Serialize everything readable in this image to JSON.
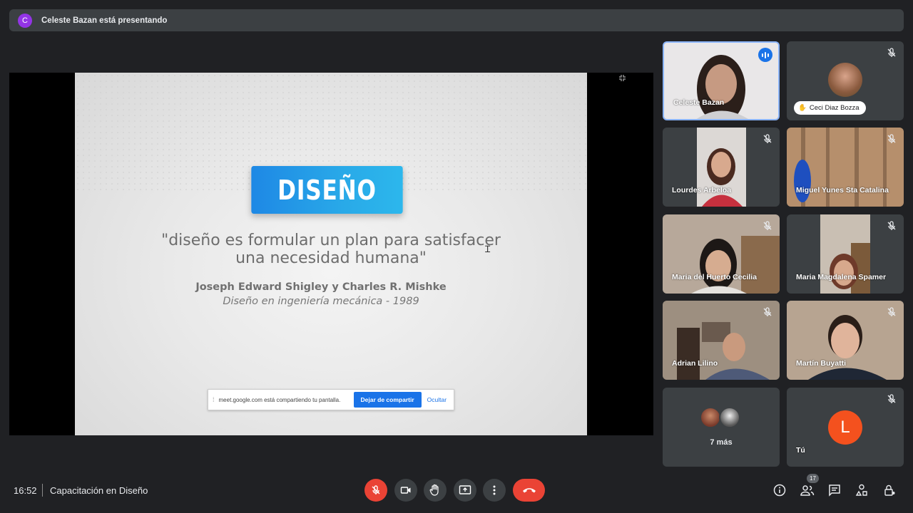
{
  "banner": {
    "initial": "C",
    "text": "Celeste Bazan está presentando"
  },
  "slide": {
    "title": "DISEÑO",
    "quote_line1": "\"diseño es formular un plan para satisfacer",
    "quote_line2": "una necesidad humana\"",
    "author": "Joseph Edward Shigley y Charles R. Mishke",
    "book": "Diseño en ingeniería mecánica - 1989"
  },
  "share_bar": {
    "message": "meet.google.com está compartiendo tu pantalla.",
    "stop_label": "Dejar de compartir",
    "hide_label": "Ocultar"
  },
  "participants": [
    {
      "name": "Celeste Bazan",
      "speaking": true
    },
    {
      "name": "Ceci Diaz Bozza",
      "muted": true,
      "hand_raised": true
    },
    {
      "name": "Lourdes Arbeloa",
      "muted": true
    },
    {
      "name": "Miguel Yunes Sta Catalina",
      "muted": true
    },
    {
      "name": "Maria del Huerto Cecilia",
      "muted": true
    },
    {
      "name": "Maria Magdalena Spamer",
      "muted": true
    },
    {
      "name": "Adrian Lilino",
      "muted": true
    },
    {
      "name": "Martín Buyatti",
      "muted": true
    }
  ],
  "more": {
    "label": "7 más"
  },
  "self": {
    "initial": "L",
    "label": "Tú"
  },
  "bottom": {
    "time": "16:52",
    "meeting_title": "Capacitación en Diseño",
    "participant_count": "17"
  },
  "colors": {
    "accent": "#1a73e8",
    "danger": "#ea4335",
    "background": "#202124",
    "tile": "#3c4043"
  }
}
